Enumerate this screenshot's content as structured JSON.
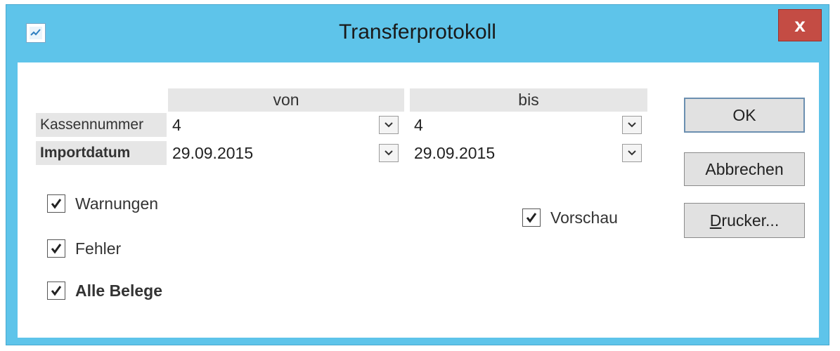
{
  "window": {
    "title": "Transferprotokoll",
    "close_label": "x"
  },
  "grid": {
    "col_von": "von",
    "col_bis": "bis",
    "rows": [
      {
        "label": "Kassennummer",
        "von": "4",
        "bis": "4"
      },
      {
        "label": "Importdatum",
        "von": "29.09.2015",
        "bis": "29.09.2015"
      }
    ]
  },
  "options": {
    "warnungen": {
      "label": "Warnungen",
      "checked": true
    },
    "fehler": {
      "label": "Fehler",
      "checked": true
    },
    "alle_belege": {
      "label": "Alle Belege",
      "checked": true
    },
    "vorschau": {
      "label": "Vorschau",
      "checked": true
    }
  },
  "buttons": {
    "ok": "OK",
    "abbrechen": "Abbrechen",
    "drucker_first": "D",
    "drucker_rest": "rucker..."
  },
  "colors": {
    "titlebar": "#5ec4ea",
    "close": "#c44c44",
    "grid_header": "#e6e6e6"
  },
  "icons": {
    "app": "chart-icon",
    "dropdown": "chevron-down-icon",
    "check": "checkmark-icon"
  }
}
